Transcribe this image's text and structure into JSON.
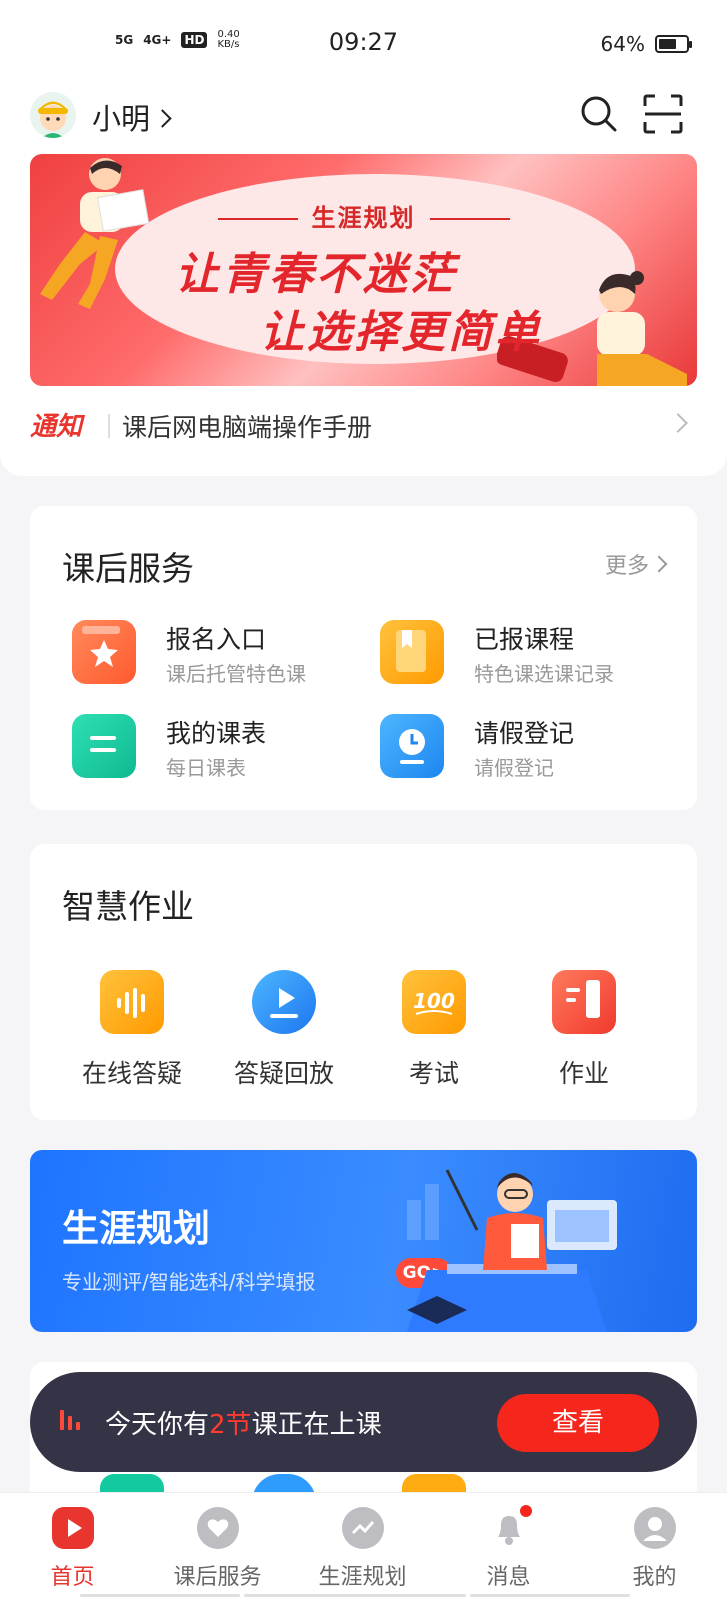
{
  "status_bar": {
    "network_1": "5G",
    "network_2": "4G+",
    "hd_badge": "HD",
    "speed": "0.40",
    "speed_unit": "KB/s",
    "time": "09:27",
    "battery_percent": "64%",
    "battery_level": 0.64
  },
  "header": {
    "user_name": "小明"
  },
  "banner": {
    "subtitle": "生涯规划",
    "line1": "让青春不迷茫",
    "line2": "让选择更简单"
  },
  "notice": {
    "tag": "通知",
    "text": "课后网电脑端操作手册"
  },
  "after_school": {
    "title": "课后服务",
    "more": "更多",
    "items": [
      {
        "title": "报名入口",
        "subtitle": "课后托管特色课",
        "color": "#ff6a3d"
      },
      {
        "title": "已报课程",
        "subtitle": "特色课选课记录",
        "color": "#ffac12"
      },
      {
        "title": "我的课表",
        "subtitle": "每日课表",
        "color": "#13c9a0"
      },
      {
        "title": "请假登记",
        "subtitle": "请假登记",
        "color": "#2e9bff"
      }
    ]
  },
  "homework": {
    "title": "智慧作业",
    "items": [
      {
        "label": "在线答疑",
        "icon": "voice-icon",
        "color": "#ffaa10"
      },
      {
        "label": "答疑回放",
        "icon": "play-icon",
        "color": "#2e8dff"
      },
      {
        "label": "考试",
        "icon": "score-100-icon",
        "color": "#ffaa10"
      },
      {
        "label": "作业",
        "icon": "book-icon",
        "color": "#f5483a"
      }
    ]
  },
  "career": {
    "title": "生涯规划",
    "subtitle": "专业测评/智能选科/科学填报",
    "go": "GO>"
  },
  "class_reminder": {
    "prefix": "今天你有",
    "count": "2节",
    "suffix": "课正在上课",
    "button": "查看"
  },
  "tabbar": {
    "items": [
      {
        "label": "首页",
        "icon": "home-play-icon",
        "active": true
      },
      {
        "label": "课后服务",
        "icon": "heart-icon",
        "active": false
      },
      {
        "label": "生涯规划",
        "icon": "trend-icon",
        "active": false
      },
      {
        "label": "消息",
        "icon": "bell-icon",
        "active": false
      },
      {
        "label": "我的",
        "icon": "user-icon",
        "active": false
      }
    ]
  },
  "colors": {
    "accent_red": "#e8352e",
    "career_blue": "#1f74ff"
  }
}
